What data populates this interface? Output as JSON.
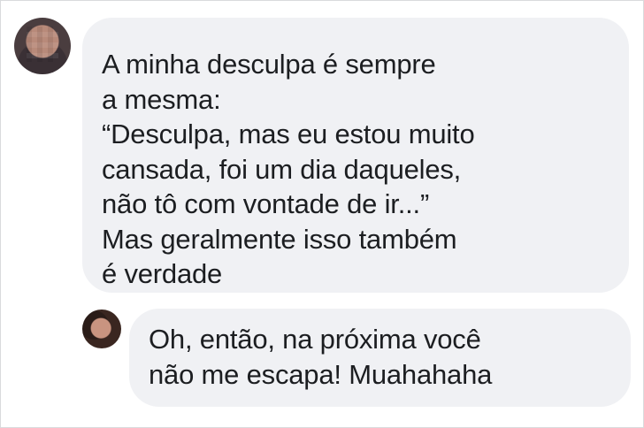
{
  "messages": [
    {
      "lines": [
        "A minha desculpa é sempre",
        "a mesma:",
        "“Desculpa, mas eu estou muito",
        "cansada, foi um dia daqueles,",
        "não tô com vontade de ir...”",
        "Mas geralmente isso também",
        "é verdade"
      ]
    },
    {
      "lines": [
        "Oh, então, na próxima você",
        "não me escapa! Muahahaha"
      ]
    }
  ],
  "colors": {
    "bubble_bg": "#f0f1f4",
    "text": "#1c1e21",
    "border": "#d9dadd"
  }
}
